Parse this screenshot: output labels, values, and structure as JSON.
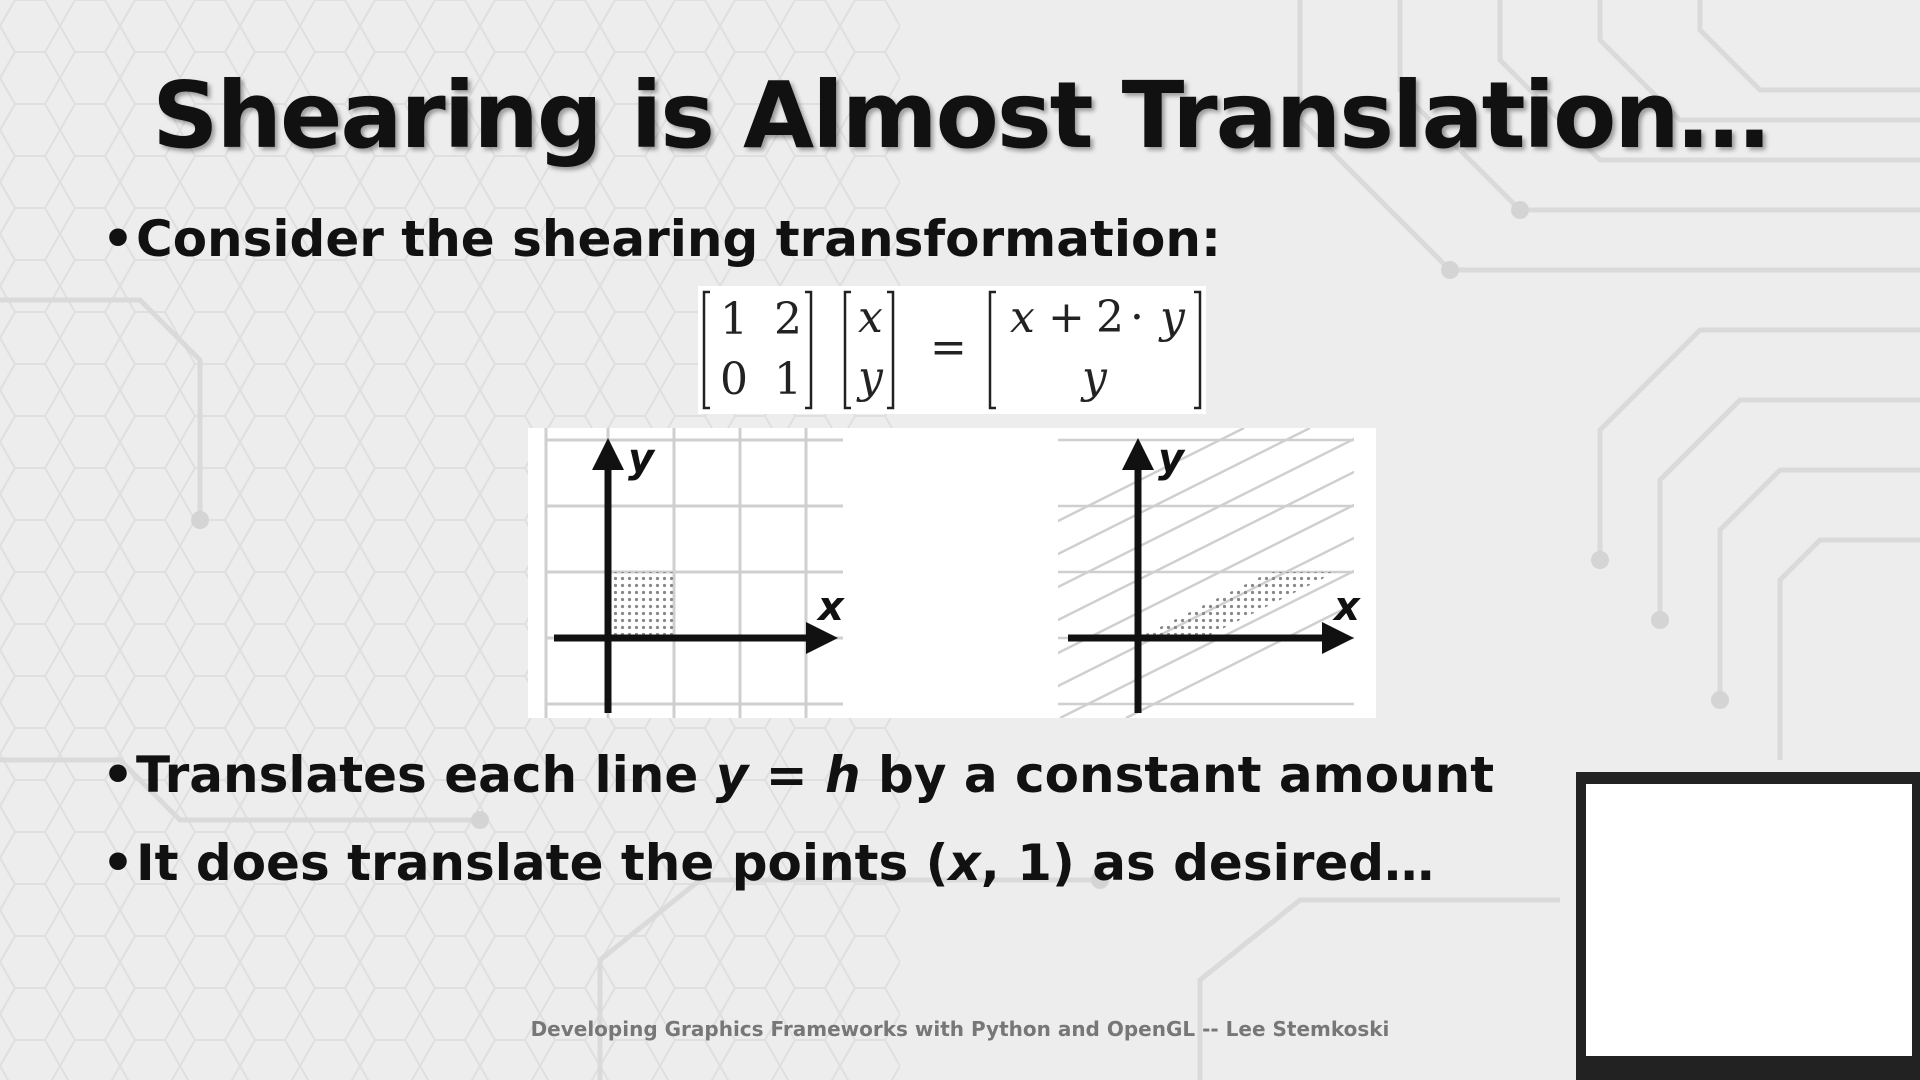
{
  "slide": {
    "title": "Shearing is Almost Translation…",
    "bullets": [
      {
        "pre": "Consider the shearing transformation:"
      },
      {
        "pre": "Translates each line ",
        "v1": "y",
        "mid": " = ",
        "v2": "h",
        "post": " by a constant amount"
      },
      {
        "pre": "It does translate the points (",
        "v1": "x",
        "post": ", 1) as desired…"
      }
    ],
    "equation": {
      "matrix": [
        "1",
        "2",
        "0",
        "1"
      ],
      "vector": [
        "x",
        "y"
      ],
      "equals": "=",
      "result_top": [
        "x",
        "+",
        "2",
        "·",
        "y"
      ],
      "result_bottom": "y"
    },
    "figure": {
      "left_labels": {
        "y": "y",
        "x": "x"
      },
      "right_labels": {
        "y": "y",
        "x": "x"
      }
    },
    "footer": "Developing Graphics Frameworks with Python and OpenGL -- Lee Stemkoski"
  },
  "colors": {
    "background": "#ececec",
    "text": "#111111",
    "footer": "#777777"
  }
}
